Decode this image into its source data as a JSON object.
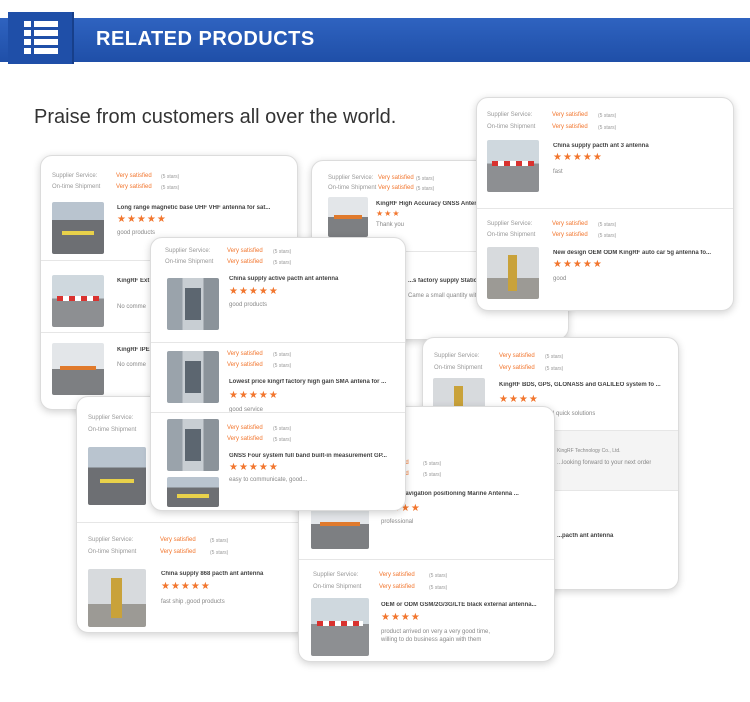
{
  "header": {
    "title": "RELATED PRODUCTS",
    "icon": "list-icon"
  },
  "tagline": "Praise from customers all over the world.",
  "labels": {
    "service": "Supplier Service:",
    "shipment": "On-time Shipment",
    "stars": "(5 stars)"
  },
  "rating_text": "Very satisfied",
  "colors": {
    "banner": "#1f4fa8",
    "accent": "#f2762e"
  },
  "cards": [
    {
      "reviews": [
        {
          "title": "Long range magnetic base UHF VHF antenna for sat...",
          "stars": "★★★★★",
          "comment": "good products"
        },
        {
          "title": "KingRF Ext",
          "stars": "",
          "comment": "No comme"
        },
        {
          "title": "KingRF IPE",
          "stars": "",
          "comment": "No comme"
        }
      ]
    },
    {
      "reviews": [
        {
          "title": "KingRF High Accuracy GNSS Antenna, Ex...",
          "stars": "★★★",
          "comment": "Thank you"
        },
        {
          "title": "...s factory supply Station high...",
          "stars": "",
          "comment": "Came a small quantity with a milo..."
        }
      ]
    },
    {
      "reviews": [
        {
          "title": "China supply pacth ant 3 antenna",
          "stars": "★★★★★",
          "comment": "fast"
        },
        {
          "title": "New design OEM ODM KingRF auto car 5g antenna fo...",
          "stars": "★★★★★",
          "comment": "good"
        }
      ]
    },
    {
      "reviews": [
        {
          "title": "China supply active pacth ant antenna",
          "stars": "★★★★★",
          "comment": "good products"
        },
        {
          "title": "Lowest price kingrf factory high gain SMA antena for ...",
          "stars": "★★★★★",
          "comment": "good service"
        },
        {
          "title": "GNSS Four system full band built-in measurement GP...",
          "stars": "★★★★★",
          "comment": "easy to communicate, good..."
        }
      ]
    },
    {
      "reviews": [
        {
          "title": "KingRF BDS, GPS, GLONASS and GALILEO system fo ...",
          "stars": "★★★★",
          "comment": "d quick solutions"
        },
        {
          "title": "KingRF Technology Co., Ltd.",
          "stars": "",
          "comment": "...looking forward to your next order"
        },
        {
          "title": "...pacth ant antenna",
          "stars": "",
          "comment": ""
        }
      ]
    },
    {
      "reviews": [
        {
          "title": "",
          "stars": "",
          "comment": ""
        },
        {
          "title": "China supply 868 pacth ant antenna",
          "stars": "★★★★★",
          "comment": "fast ship ,good products"
        }
      ]
    },
    {
      "reviews": [
        {
          "title": "...ower navigation positioning Marine Antenna ...",
          "stars": "★★★★",
          "comment": "professional"
        },
        {
          "title": "OEM or ODM GSM/2G/3G/LTE black external antenna...",
          "stars": "★★★★",
          "comment": "product arrived on very a very good time,",
          "comment2": "willing to do business again with them"
        }
      ]
    }
  ]
}
